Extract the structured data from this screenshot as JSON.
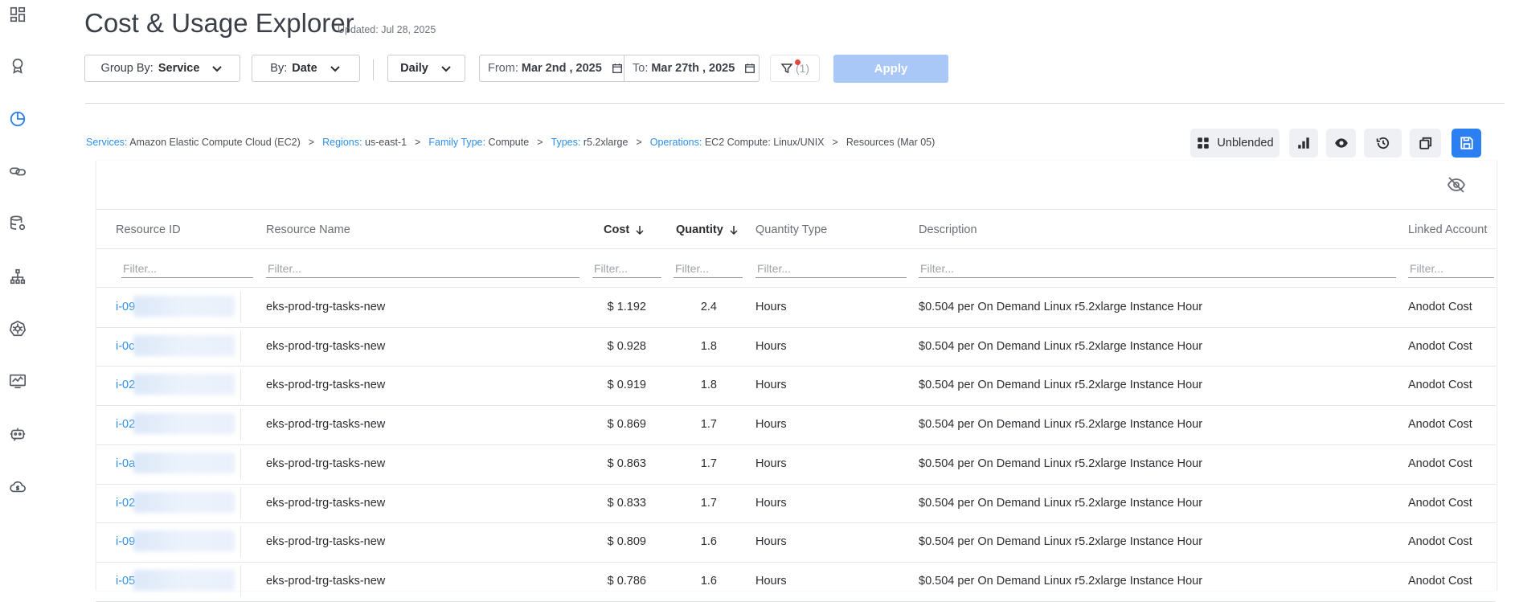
{
  "page": {
    "title": "Cost & Usage Explorer",
    "updated": "Updated: Jul 28, 2025"
  },
  "toolbar": {
    "group_by_label": "Group By:",
    "group_by_value": "Service",
    "by_label": "By:",
    "by_value": "Date",
    "granularity": "Daily",
    "from_label": "From:",
    "from_value": "Mar 2nd , 2025",
    "to_label": "To:",
    "to_value": "Mar 27th , 2025",
    "filter_count": "(1)",
    "apply_label": "Apply"
  },
  "breadcrumb": [
    {
      "key": "Services:",
      "value": "Amazon Elastic Compute Cloud (EC2)"
    },
    {
      "key": "Regions:",
      "value": "us-east-1"
    },
    {
      "key": "Family Type:",
      "value": "Compute"
    },
    {
      "key": "Types:",
      "value": "r5.2xlarge"
    },
    {
      "key": "Operations:",
      "value": "EC2 Compute: Linux/UNIX"
    },
    {
      "key": "",
      "value": "Resources (Mar 05)"
    }
  ],
  "breadcrumb_separator": ">",
  "actions": {
    "cost_type_label": "Unblended"
  },
  "table": {
    "columns": {
      "resource_id": "Resource ID",
      "resource_name": "Resource Name",
      "cost": "Cost",
      "quantity": "Quantity",
      "quantity_type": "Quantity Type",
      "description": "Description",
      "linked_account": "Linked Account"
    },
    "filter_placeholder": "Filter...",
    "rows": [
      {
        "id": "i-09",
        "name": "eks-prod-trg-tasks-new",
        "cost": "$ 1.192",
        "quantity": "2.4",
        "qtype": "Hours",
        "desc": "$0.504 per On Demand Linux r5.2xlarge Instance Hour",
        "account": "Anodot Cost"
      },
      {
        "id": "i-0c",
        "name": "eks-prod-trg-tasks-new",
        "cost": "$ 0.928",
        "quantity": "1.8",
        "qtype": "Hours",
        "desc": "$0.504 per On Demand Linux r5.2xlarge Instance Hour",
        "account": "Anodot Cost"
      },
      {
        "id": "i-02",
        "name": "eks-prod-trg-tasks-new",
        "cost": "$ 0.919",
        "quantity": "1.8",
        "qtype": "Hours",
        "desc": "$0.504 per On Demand Linux r5.2xlarge Instance Hour",
        "account": "Anodot Cost"
      },
      {
        "id": "i-02",
        "name": "eks-prod-trg-tasks-new",
        "cost": "$ 0.869",
        "quantity": "1.7",
        "qtype": "Hours",
        "desc": "$0.504 per On Demand Linux r5.2xlarge Instance Hour",
        "account": "Anodot Cost"
      },
      {
        "id": "i-0a",
        "name": "eks-prod-trg-tasks-new",
        "cost": "$ 0.863",
        "quantity": "1.7",
        "qtype": "Hours",
        "desc": "$0.504 per On Demand Linux r5.2xlarge Instance Hour",
        "account": "Anodot Cost"
      },
      {
        "id": "i-02",
        "name": "eks-prod-trg-tasks-new",
        "cost": "$ 0.833",
        "quantity": "1.7",
        "qtype": "Hours",
        "desc": "$0.504 per On Demand Linux r5.2xlarge Instance Hour",
        "account": "Anodot Cost"
      },
      {
        "id": "i-09",
        "name": "eks-prod-trg-tasks-new",
        "cost": "$ 0.809",
        "quantity": "1.6",
        "qtype": "Hours",
        "desc": "$0.504 per On Demand Linux r5.2xlarge Instance Hour",
        "account": "Anodot Cost"
      },
      {
        "id": "i-05",
        "name": "eks-prod-trg-tasks-new",
        "cost": "$ 0.786",
        "quantity": "1.6",
        "qtype": "Hours",
        "desc": "$0.504 per On Demand Linux r5.2xlarge Instance Hour",
        "account": "Anodot Cost"
      }
    ]
  },
  "colors": {
    "accent": "#2b7ff0",
    "link": "#2e8ee8",
    "apply_disabled": "#a9c8f7",
    "filter_dot": "#e8443a"
  },
  "sidebar_icons": [
    "dashboard-icon",
    "badge-icon",
    "cost-chart-icon",
    "link-icon",
    "database-settings-icon",
    "hierarchy-icon",
    "kubernetes-icon",
    "monitoring-icon",
    "bot-icon",
    "cloud-cost-icon"
  ]
}
